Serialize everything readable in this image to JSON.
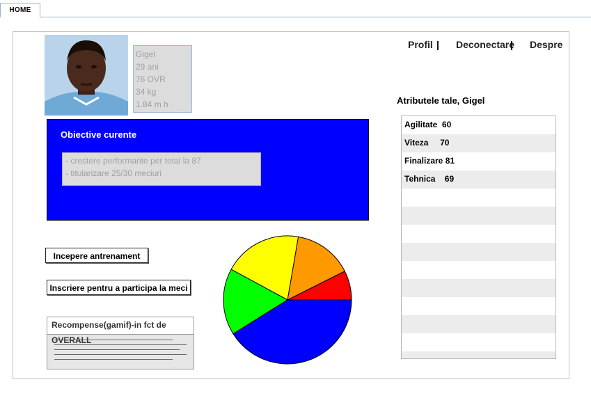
{
  "tabs": [
    {
      "label": "HOME"
    }
  ],
  "profile": {
    "name": "Gigel",
    "age": "29 ani",
    "ovr": "76 OVR",
    "weight": "34 kg",
    "height": "1.84 m h"
  },
  "nav": {
    "profile": "Profil",
    "logout": "Deconectare",
    "about": "Despre",
    "separator": "|"
  },
  "objectives": {
    "title": "Obiective curente",
    "items": [
      "- crestere performante per total la 87",
      "- titularizare 25/30 meciuri"
    ]
  },
  "buttons": {
    "start_training": "Incepere antrenament",
    "register_match": "Inscriere pentru a participa la meci"
  },
  "rewards": {
    "title": "Recompense(gamif)-in fct de OVERALL"
  },
  "attributes": {
    "title": "Atributele tale, Gigel",
    "rows": [
      "Agilitate  60",
      "Viteza     70",
      "Finalizare 81",
      "Tehnica    69",
      "",
      "",
      "",
      "",
      "",
      "",
      "",
      "",
      "",
      ""
    ]
  },
  "pie": {
    "colors": [
      "#ff0000",
      "#ff9900",
      "#ffff00",
      "#00ff00",
      "#0000ff"
    ],
    "fractions": [
      0.074,
      0.149,
      0.198,
      0.168,
      0.411
    ]
  }
}
